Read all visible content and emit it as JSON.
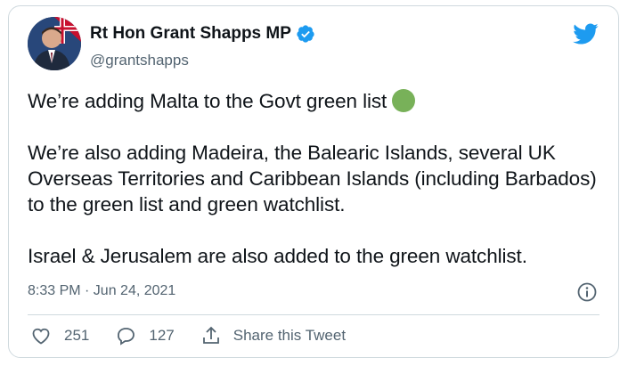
{
  "user": {
    "display_name": "Rt Hon Grant Shapps MP",
    "handle": "@grantshapps",
    "verified": true
  },
  "tweet": {
    "line1": "We’re adding Malta to the Govt green list ",
    "emoji": "green-circle",
    "para2": "We’re also adding Madeira, the Balearic Islands, several UK Overseas Territories and Caribbean Islands (including Barbados) to the green list and green watchlist.",
    "para3": "Israel & Jerusalem are also added to the green watchlist.",
    "timestamp": "8:33 PM · Jun 24, 2021"
  },
  "actions": {
    "likes": "251",
    "replies": "127",
    "share_label": "Share this Tweet"
  },
  "colors": {
    "twitter_blue": "#1d9bf0",
    "text": "#0f1419",
    "muted": "#536471",
    "green_emoji": "#78b159"
  },
  "icons": [
    "verified-badge-icon",
    "twitter-bird-icon",
    "info-icon",
    "heart-icon",
    "reply-icon",
    "share-icon"
  ]
}
